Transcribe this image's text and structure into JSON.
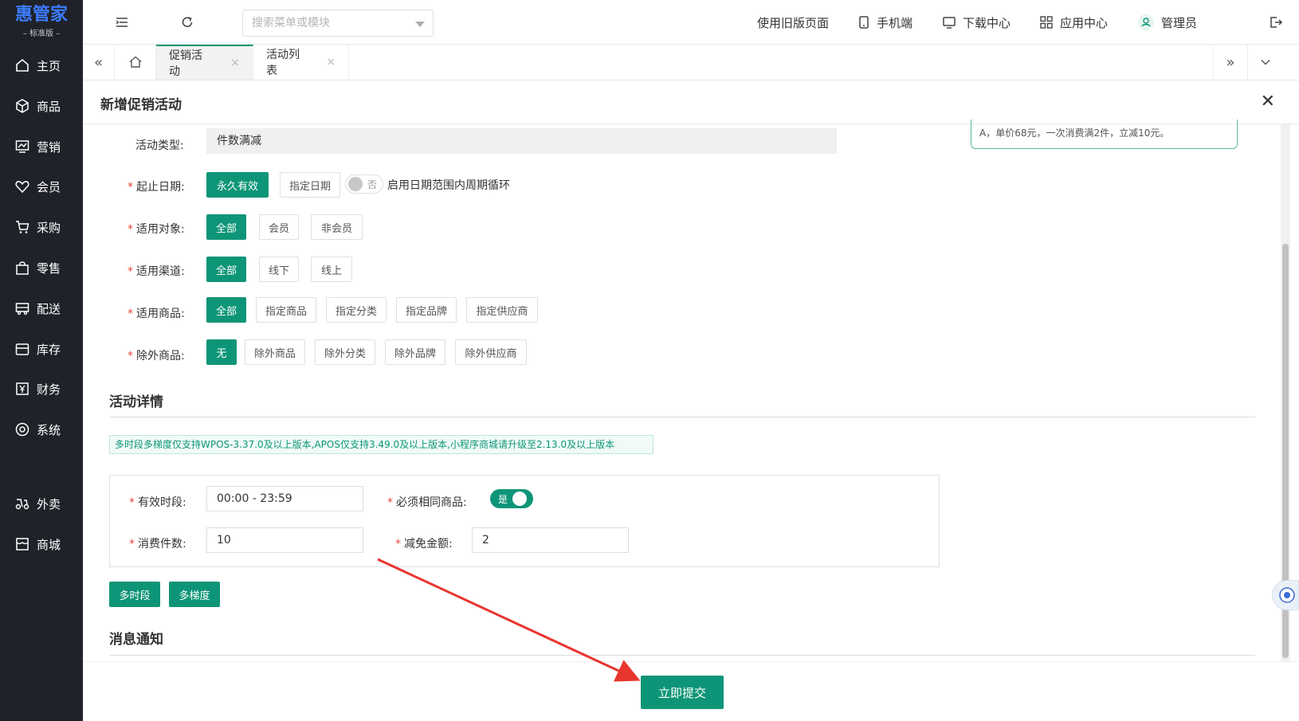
{
  "brand": {
    "name": "惠管家",
    "edition": "标准版"
  },
  "sidebar": {
    "items": [
      {
        "label": "主页",
        "icon": "home-icon"
      },
      {
        "label": "商品",
        "icon": "box-icon"
      },
      {
        "label": "营销",
        "icon": "chart-icon"
      },
      {
        "label": "会员",
        "icon": "heart-icon"
      },
      {
        "label": "采购",
        "icon": "cart-icon"
      },
      {
        "label": "零售",
        "icon": "bag-icon"
      },
      {
        "label": "配送",
        "icon": "truck-icon"
      },
      {
        "label": "库存",
        "icon": "warehouse-icon"
      },
      {
        "label": "财务",
        "icon": "yen-icon"
      },
      {
        "label": "系统",
        "icon": "settings-icon"
      },
      {
        "label": "外卖",
        "icon": "scooter-icon"
      },
      {
        "label": "商城",
        "icon": "store-icon"
      }
    ]
  },
  "topbar": {
    "search_placeholder": "搜索菜单或模块",
    "old_page": "使用旧版页面",
    "mobile": "手机端",
    "download": "下载中心",
    "apps": "应用中心",
    "user": "管理员"
  },
  "tabs": [
    {
      "label": "促销活动",
      "active": true
    },
    {
      "label": "活动列表",
      "active": false
    }
  ],
  "modal": {
    "title": "新增促销活动",
    "tip": "A，单价68元，一次消费满2件，立减10元。"
  },
  "form": {
    "type_label": "活动类型:",
    "type_value": "件数满减",
    "date_label": "起止日期:",
    "date_options": [
      "永久有效",
      "指定日期"
    ],
    "cycle_toggle": "否",
    "cycle_label": "启用日期范围内周期循环",
    "target_label": "适用对象:",
    "target_options": [
      "全部",
      "会员",
      "非会员"
    ],
    "channel_label": "适用渠道:",
    "channel_options": [
      "全部",
      "线下",
      "线上"
    ],
    "goods_label": "适用商品:",
    "goods_options": [
      "全部",
      "指定商品",
      "指定分类",
      "指定品牌",
      "指定供应商"
    ],
    "exclude_label": "除外商品:",
    "exclude_options": [
      "无",
      "除外商品",
      "除外分类",
      "除外品牌",
      "除外供应商"
    ]
  },
  "details": {
    "title": "活动详情",
    "notice": "多时段多梯度仅支持WPOS-3.37.0及以上版本,APOS仅支持3.49.0及以上版本,小程序商城请升级至2.13.0及以上版本",
    "period_label": "有效时段:",
    "period_value": "00:00 - 23:59",
    "same_goods_label": "必须相同商品:",
    "same_goods_toggle": "是",
    "qty_label": "消费件数:",
    "qty_value": "10",
    "discount_label": "减免金额:",
    "discount_value": "2",
    "multi_period": "多时段",
    "multi_tier": "多梯度"
  },
  "message": {
    "title": "消息通知"
  },
  "footer": {
    "submit": "立即提交"
  },
  "colors": {
    "accent": "#0e9577",
    "sidebar": "#1f2229",
    "required": "#e6483d",
    "arrow": "#e8362f"
  }
}
